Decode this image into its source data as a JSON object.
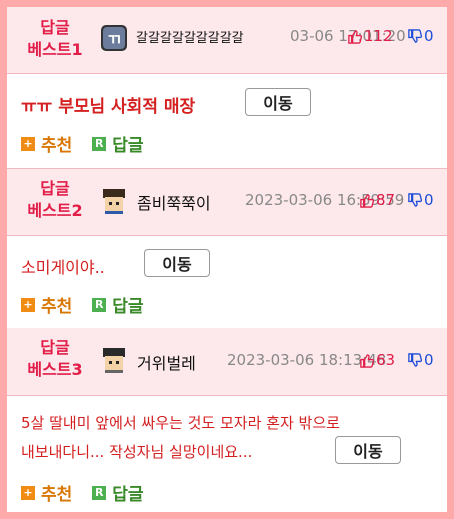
{
  "posts": [
    {
      "rank_line1": "답글",
      "rank_line2": "베스트1",
      "nickname": "갈갈갈갈갈갈갈갈갈",
      "date": "03-06 17:01:20",
      "up": "112",
      "down": "0",
      "title": "ㅠㅠ 부모님 사회적 매장",
      "move_label": "이동",
      "recommend_label": "추천",
      "reply_label": "답글"
    },
    {
      "rank_line1": "답글",
      "rank_line2": "베스트2",
      "nickname": "좀비쭉쭉이",
      "date": "2023-03-06 16:59:59",
      "up": "87",
      "down": "0",
      "title": "소미게이야..",
      "move_label": "이동",
      "recommend_label": "추천",
      "reply_label": "답글"
    },
    {
      "rank_line1": "답글",
      "rank_line2": "베스트3",
      "nickname": "거위벌레",
      "date": "2023-03-06 18:13:48",
      "up": "63",
      "down": "0",
      "title_line1": "5살 딸내미 앞에서 싸우는 것도 모자라 혼자 밖으로",
      "title_line2": "내보내다니... 작성자님 실망이네요...",
      "move_label": "이동",
      "recommend_label": "추천",
      "reply_label": "답글"
    }
  ],
  "icons": {
    "plus": "+",
    "reply_badge": "R"
  },
  "colors": {
    "border": "#ffaaaa",
    "header_bg": "#fde9ec",
    "rank": "#e11d48",
    "title": "#d42020",
    "recommend": "#d97706",
    "reply": "#3a8a2a"
  }
}
